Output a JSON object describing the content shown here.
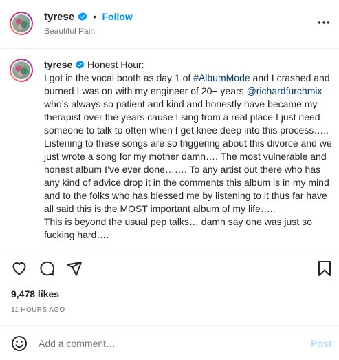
{
  "header": {
    "username": "tyrese",
    "separator": "•",
    "follow_label": "Follow",
    "subtitle": "Beautiful Pain",
    "more_icon": "more-horizontal-icon"
  },
  "caption": {
    "username": "tyrese",
    "text_1": "Honest Hour:",
    "text_2": "I got in the vocal booth as day 1 of",
    "hashtag": "#AlbumMode",
    "text_3": "and I crashed and burned I was on with my engineer of 20+ years",
    "mention": "@richardfurchmix",
    "text_4": "who’s always so patient and kind and honestly have became my therapist over the years cause I sing from a real place I just need someone to talk to often when I get knee deep into this process….. Listening to these songs are so triggering about this divorce and we just wrote a song for my mother damn…. The most vulnerable and honest album I’ve ever done……. To any artist out there who has any kind of advice drop it in the comments this album is in my mind and to the folks who has blessed me by listening to it thus far have all said this is the MOST important album of my life…..",
    "text_5": "This is beyond the usual pep talks… damn say one was just so fucking hard…."
  },
  "actions": {
    "like_icon": "heart-icon",
    "comment_icon": "comment-icon",
    "share_icon": "send-icon",
    "save_icon": "bookmark-icon"
  },
  "stats": {
    "likes": "9,478 likes",
    "timestamp": "11 HOURS AGO"
  },
  "comment_box": {
    "emoji_icon": "emoji-icon",
    "placeholder": "Add a comment…",
    "post_label": "Post"
  },
  "colors": {
    "link_blue": "#0095f6",
    "verified_blue": "#0095f6",
    "post_disabled": "#b3dbff"
  }
}
